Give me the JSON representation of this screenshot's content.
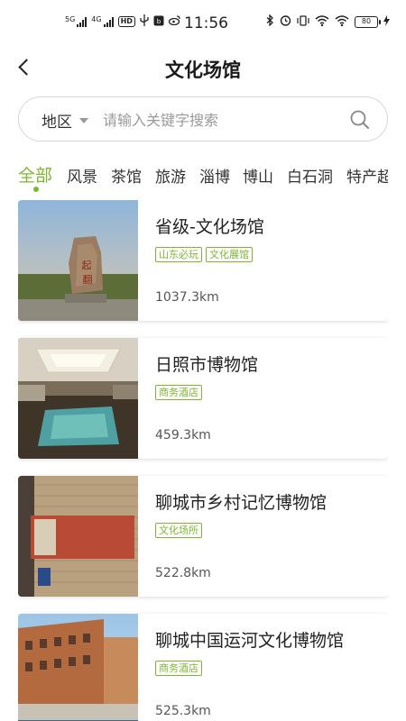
{
  "status_bar": {
    "net1": "5G",
    "net2": "4G",
    "hd": "HD",
    "time": "11:56",
    "battery": "80"
  },
  "header": {
    "title": "文化场馆"
  },
  "search": {
    "region_label": "地区",
    "placeholder": "请输入关键字搜索"
  },
  "tabs": [
    {
      "label": "全部",
      "active": true
    },
    {
      "label": "风景"
    },
    {
      "label": "茶馆"
    },
    {
      "label": "旅游"
    },
    {
      "label": "淄博"
    },
    {
      "label": "博山"
    },
    {
      "label": "白石洞"
    },
    {
      "label": "特产超"
    }
  ],
  "venues": [
    {
      "name": "省级-文化场馆",
      "tags": [
        "山东必玩",
        "文化展馆"
      ],
      "distance": "1037.3km"
    },
    {
      "name": "日照市博物馆",
      "tags": [
        "商务酒店"
      ],
      "distance": "459.3km"
    },
    {
      "name": "聊城市乡村记忆博物馆",
      "tags": [
        "文化场所"
      ],
      "distance": "522.8km"
    },
    {
      "name": "聊城中国运河文化博物馆",
      "tags": [
        "商务酒店"
      ],
      "distance": "525.3km"
    }
  ],
  "colors": {
    "accent": "#7cb82f"
  }
}
